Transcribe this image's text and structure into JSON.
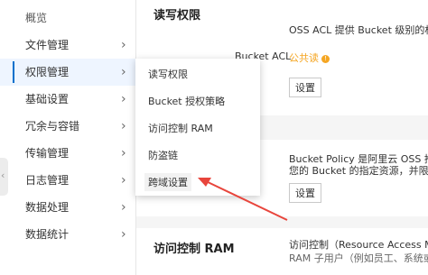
{
  "sidebar": {
    "items": [
      {
        "label": "概览"
      },
      {
        "label": "文件管理"
      },
      {
        "label": "权限管理"
      },
      {
        "label": "基础设置"
      },
      {
        "label": "冗余与容错"
      },
      {
        "label": "传输管理"
      },
      {
        "label": "日志管理"
      },
      {
        "label": "数据处理"
      },
      {
        "label": "数据统计"
      }
    ]
  },
  "submenu": {
    "items": [
      {
        "label": "读写权限"
      },
      {
        "label": "Bucket 授权策略"
      },
      {
        "label": "访问控制 RAM"
      },
      {
        "label": "防盗链"
      },
      {
        "label": "跨域设置"
      }
    ]
  },
  "main": {
    "section1": {
      "title": "读写权限",
      "desc": "OSS ACL 提供 Bucket 级别的权限访问",
      "field_label": "Bucket ACL",
      "acl_value": "公共读",
      "warn_glyph": "!",
      "button": "设置"
    },
    "section2": {
      "desc_line1": "Bucket Policy 是阿里云 OSS 推出的针",
      "desc_line2": "您的 Bucket 的指定资源，并限制访问访",
      "button": "设置"
    },
    "section3": {
      "title": "访问控制 RAM",
      "desc_line1": "访问控制（Resource Access Manage",
      "desc_line2": "RAM 子用户（例如员工、系统或应用"
    }
  },
  "colors": {
    "accent": "#0070cc",
    "warning": "#f5a623",
    "annotation_arrow": "#e8453c"
  }
}
